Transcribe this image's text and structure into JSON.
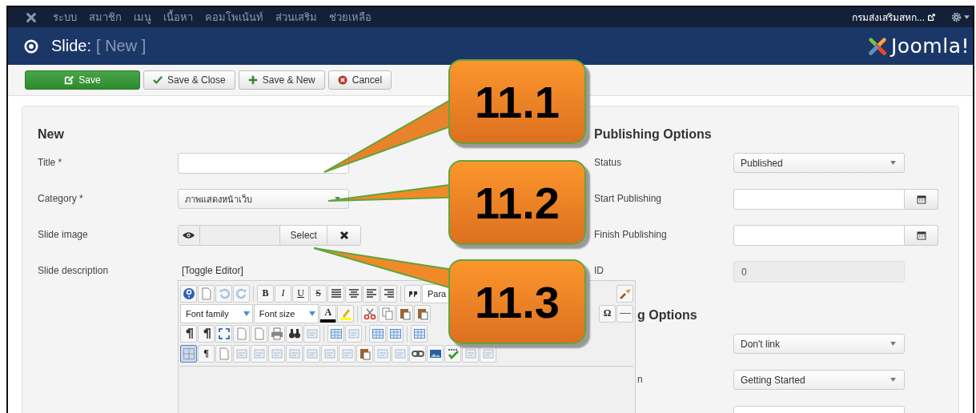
{
  "top_menu": {
    "items": [
      "ระบบ",
      "สมาชิก",
      "เมนู",
      "เนื้อหา",
      "คอมโพเน้นท์",
      "ส่วนเสริม",
      "ช่วยเหลือ"
    ],
    "site_link": "กรมส่งเสริมสหก..."
  },
  "header": {
    "title": "Slide:",
    "subtitle": "[ New ]",
    "logo_text": "Joomla!"
  },
  "toolbar": [
    {
      "kind": "save",
      "label": "Save"
    },
    {
      "kind": "check",
      "label": "Save & Close"
    },
    {
      "kind": "plus",
      "label": "Save & New"
    },
    {
      "kind": "cancel",
      "label": "Cancel"
    }
  ],
  "form": {
    "heading": "New",
    "fields": [
      {
        "kind": "text",
        "label": "Title *"
      },
      {
        "kind": "select",
        "label": "Category *",
        "value": "ภาพแสดงหน้าเว็บ"
      },
      {
        "kind": "media",
        "label": "Slide image",
        "button": "Select"
      },
      {
        "kind": "editor",
        "label": "Slide description",
        "toggle": "[Toggle Editor]"
      }
    ]
  },
  "editor": {
    "rows": [
      {
        "items": [
          {
            "kind": "help"
          },
          {
            "kind": "page"
          },
          {
            "kind": "undo"
          },
          {
            "kind": "redo"
          },
          {
            "kind": "sep"
          },
          {
            "kind": "letter",
            "label": "B"
          },
          {
            "kind": "italic",
            "label": "I"
          },
          {
            "kind": "underline",
            "label": "U"
          },
          {
            "kind": "strike",
            "label": "S"
          },
          {
            "kind": "justify"
          },
          {
            "kind": "center"
          },
          {
            "kind": "left"
          },
          {
            "kind": "right"
          },
          {
            "kind": "sep"
          },
          {
            "kind": "quote"
          },
          {
            "kind": "select",
            "label": "Para"
          }
        ],
        "end": [
          {
            "kind": "brush"
          }
        ]
      },
      {
        "items": [
          {
            "kind": "select",
            "label": "Font family"
          },
          {
            "kind": "select",
            "label": "Font size"
          },
          {
            "kind": "color",
            "label": "A"
          },
          {
            "kind": "highlight"
          },
          {
            "kind": "sep"
          },
          {
            "kind": "cut"
          },
          {
            "kind": "copy"
          },
          {
            "kind": "paste"
          },
          {
            "kind": "paste"
          }
        ],
        "end": [
          {
            "kind": "letter",
            "label": "Ω"
          },
          {
            "kind": "hr"
          }
        ]
      },
      {
        "items": [
          {
            "kind": "direction"
          },
          {
            "kind": "direction"
          },
          {
            "kind": "fullscreen"
          },
          {
            "kind": "page"
          },
          {
            "kind": "page"
          },
          {
            "kind": "print"
          },
          {
            "kind": "find"
          },
          {
            "kind": "generic"
          },
          {
            "kind": "sep"
          },
          {
            "kind": "table"
          },
          {
            "kind": "generic"
          },
          {
            "kind": "sep"
          },
          {
            "kind": "table"
          },
          {
            "kind": "table"
          },
          {
            "kind": "sep"
          },
          {
            "kind": "table"
          }
        ],
        "end": []
      },
      {
        "items": [
          {
            "kind": "grid"
          },
          {
            "kind": "letter",
            "label": "¶"
          },
          {
            "kind": "page"
          },
          {
            "kind": "generic"
          },
          {
            "kind": "generic"
          },
          {
            "kind": "generic"
          },
          {
            "kind": "generic"
          },
          {
            "kind": "generic"
          },
          {
            "kind": "generic"
          },
          {
            "kind": "generic"
          },
          {
            "kind": "paste"
          },
          {
            "kind": "generic"
          },
          {
            "kind": "generic"
          },
          {
            "kind": "link"
          },
          {
            "kind": "image"
          },
          {
            "kind": "spell"
          },
          {
            "kind": "generic"
          },
          {
            "kind": "generic"
          }
        ],
        "end": []
      }
    ]
  },
  "options": {
    "sections": [
      {
        "kind": "plain",
        "heading": "Publishing Options",
        "fields": [
          {
            "kind": "select",
            "label": "Status",
            "value": "Published"
          },
          {
            "kind": "date",
            "label": "Start Publishing"
          },
          {
            "kind": "date",
            "label": "Finish Publishing"
          },
          {
            "kind": "readonly",
            "label": "ID",
            "value": "0"
          }
        ]
      },
      {
        "kind": "behind-editor",
        "heading": "g Options",
        "fields": [
          {
            "kind": "select",
            "value": "Don't link"
          },
          {
            "kind": "select",
            "label": "n",
            "value": "Getting Started"
          },
          {
            "kind": "text"
          }
        ]
      }
    ]
  },
  "callouts": [
    {
      "label": "11.1"
    },
    {
      "label": "11.2"
    },
    {
      "label": "11.3"
    }
  ]
}
